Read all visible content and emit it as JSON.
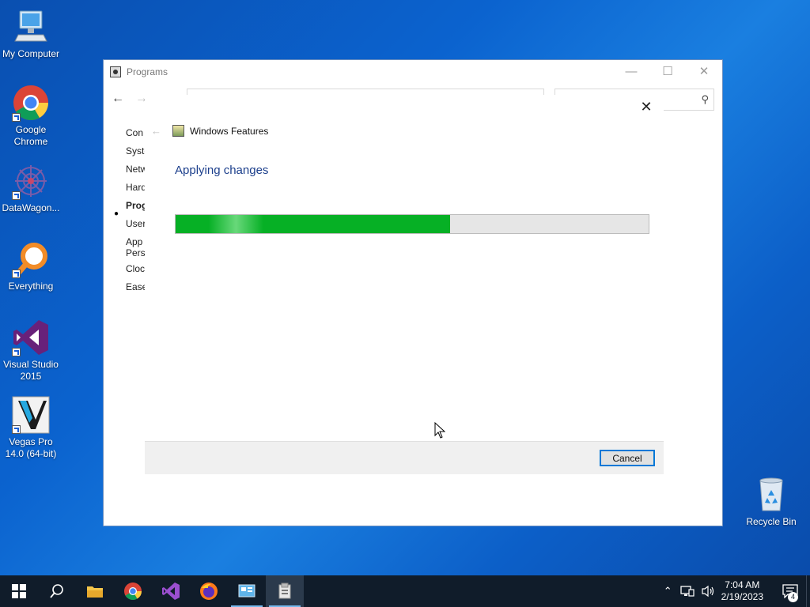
{
  "desktop": {
    "icons": [
      {
        "label": "My Computer"
      },
      {
        "label": "Google Chrome"
      },
      {
        "label": "DataWagon..."
      },
      {
        "label": "Everything"
      },
      {
        "label": "Visual Studio 2015"
      },
      {
        "label": "Vegas Pro 14.0 (64-bit)"
      },
      {
        "label": "Recycle Bin"
      }
    ]
  },
  "programs_window": {
    "title": "Programs",
    "sidebar_items": [
      "Con",
      "Syste",
      "Netw",
      "Hard",
      "Prog",
      "User",
      "App Pers",
      "Clock",
      "Ease"
    ],
    "active_sidebar_index": 4
  },
  "features_dialog": {
    "title": "Windows Features",
    "status": "Applying changes",
    "progress_fraction": 0.58,
    "cancel_label": "Cancel"
  },
  "taskbar": {
    "apps": [
      "start-icon",
      "search-icon",
      "file-explorer-icon",
      "chrome-icon",
      "visual-studio-icon",
      "firefox-icon",
      "control-panel-icon",
      "windows-features-icon"
    ],
    "time": "7:04 AM",
    "date": "2/19/2023",
    "notification_count": "4"
  },
  "colors": {
    "progress_fill": "#06b025",
    "accent": "#0078d7",
    "heading": "#1c3f8c"
  }
}
